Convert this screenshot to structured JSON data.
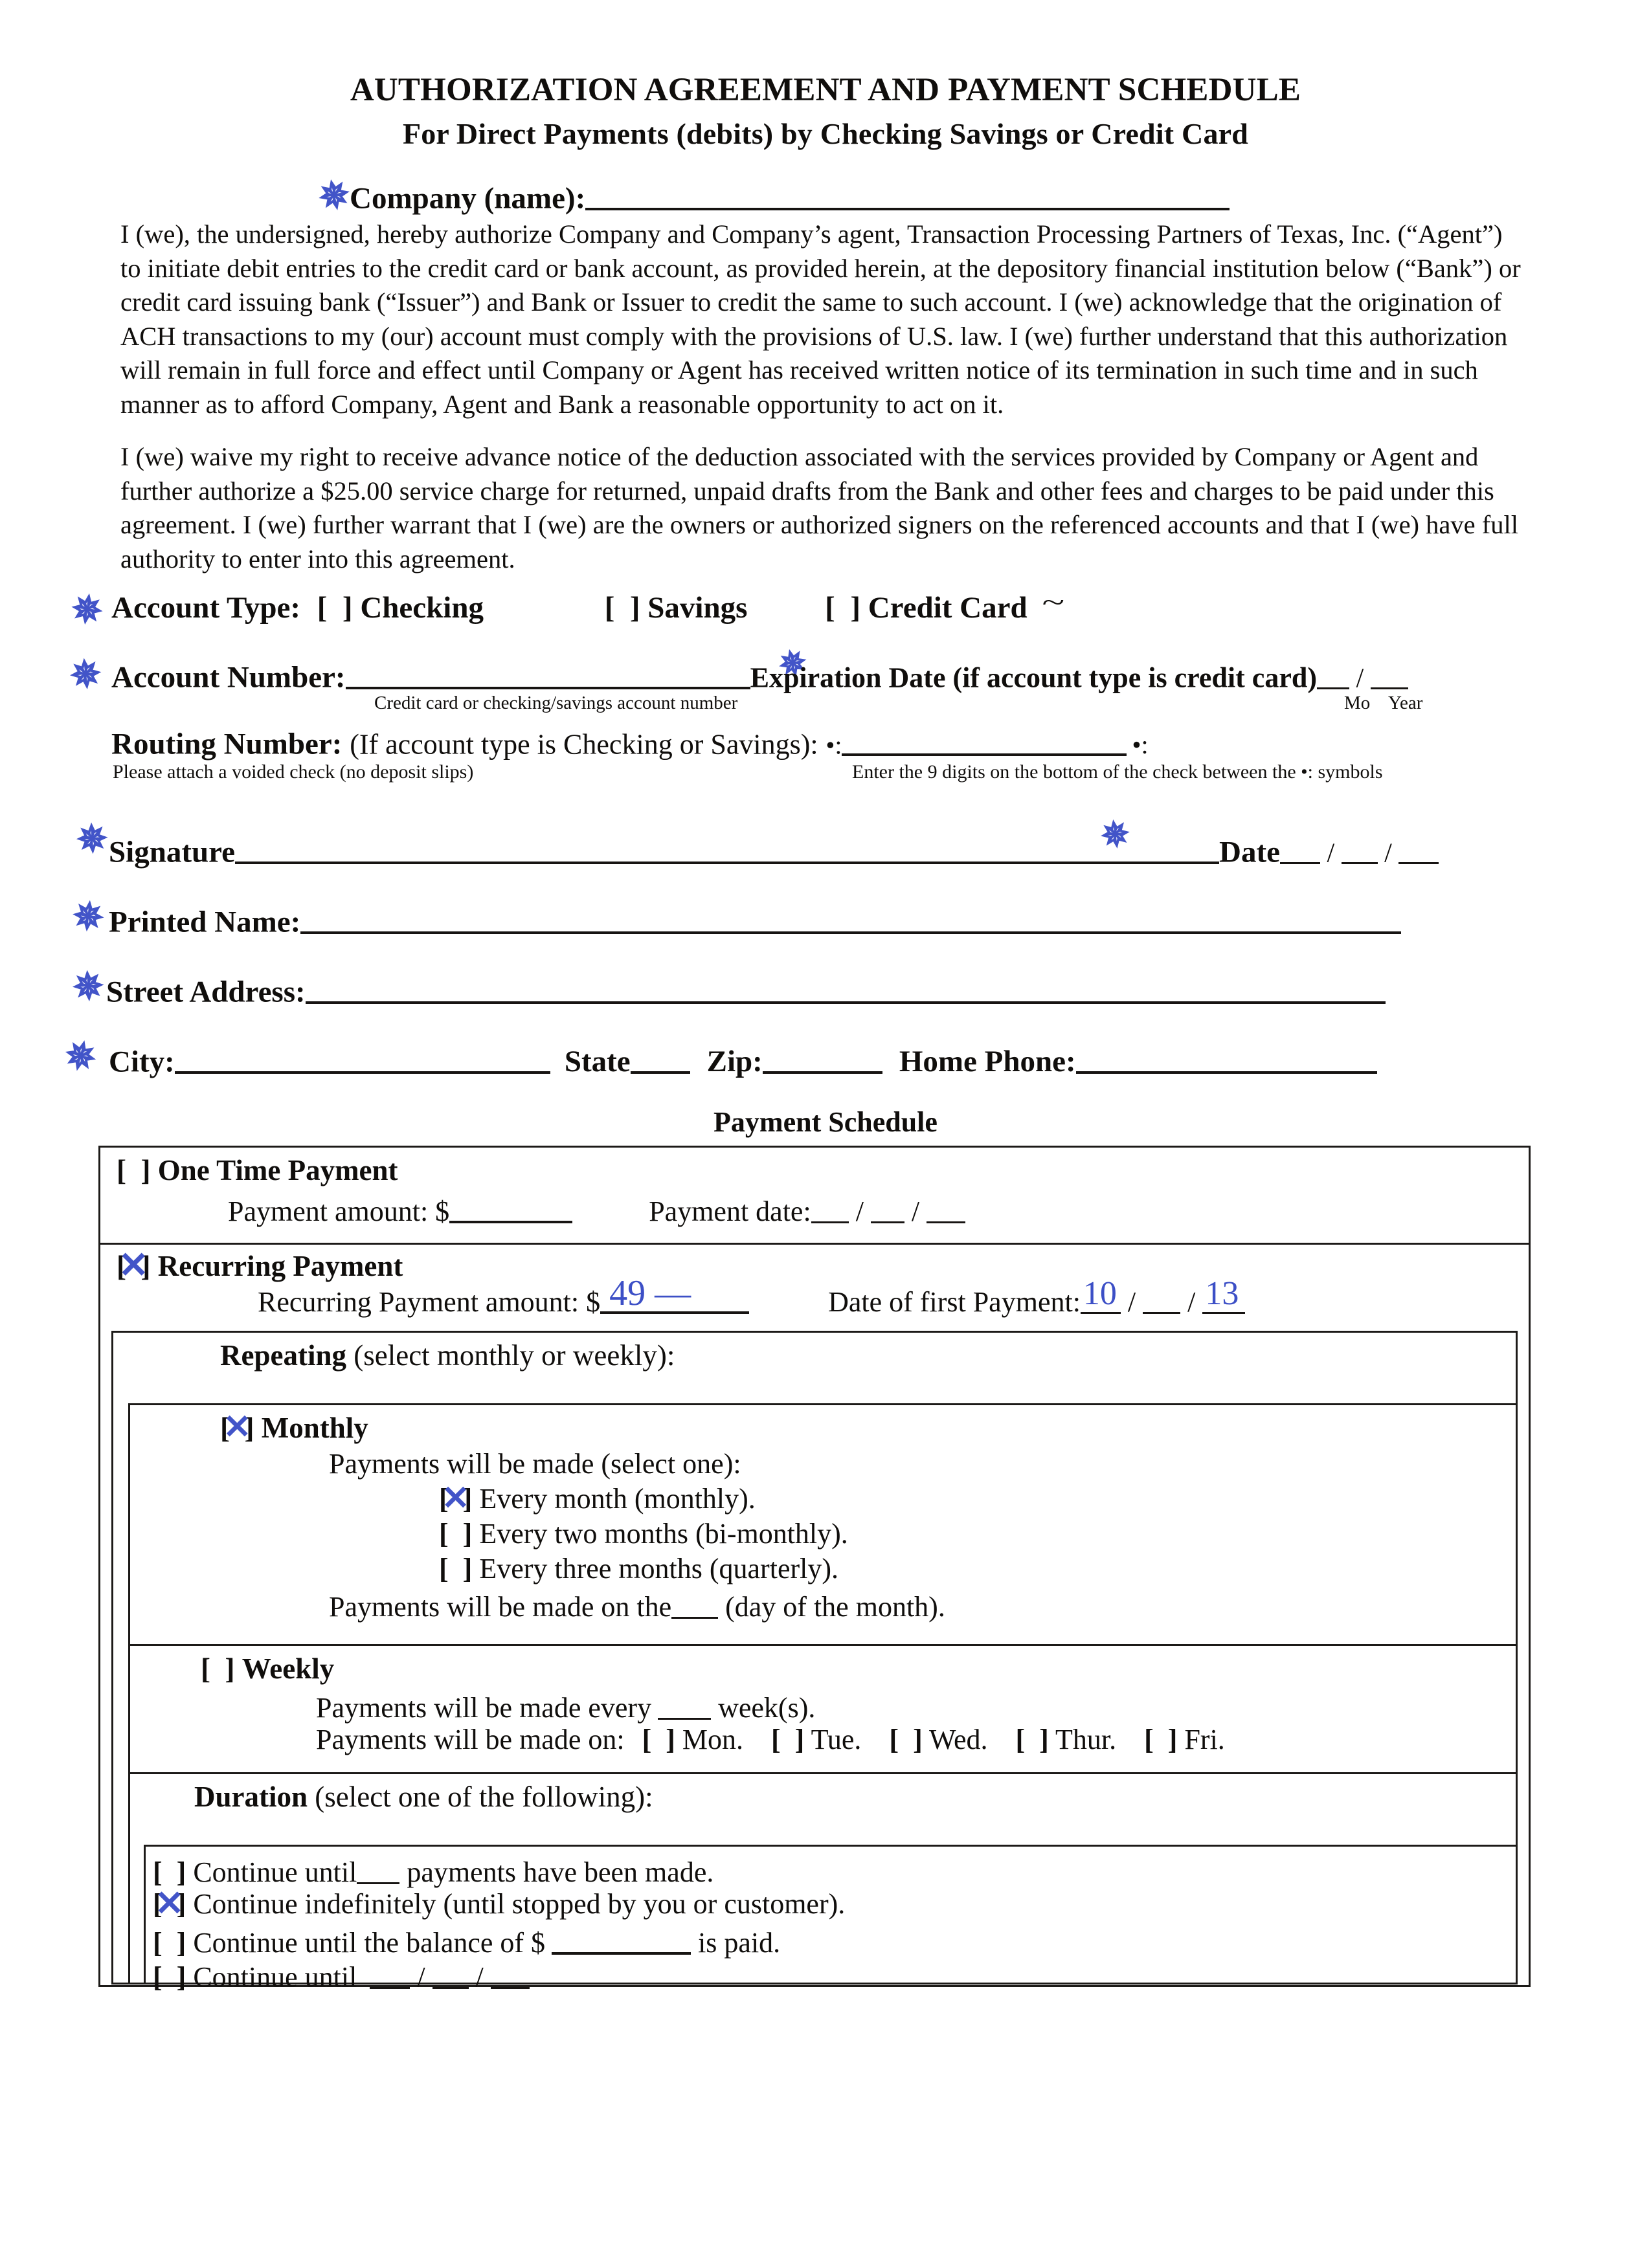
{
  "document": {
    "title_line1": "AUTHORIZATION AGREEMENT AND PAYMENT SCHEDULE",
    "title_line2": "For Direct Payments (debits) by Checking Savings or Credit Card"
  },
  "company": {
    "label": "Company (name):",
    "value": "",
    "pen_mark": "star-mark"
  },
  "body": {
    "paragraph1": "I (we), the undersigned, hereby authorize Company and Company’s agent, Transaction Processing Partners of Texas, Inc. (“Agent”) to initiate debit entries to the credit card or bank account, as provided herein, at the depository financial institution below (“Bank”) or credit card issuing bank (“Issuer”) and Bank or Issuer to credit the same to such account.  I (we) acknowledge that the origination of ACH transactions to my (our) account must comply with the provisions of U.S. law.  I (we) further understand that this authorization will remain in full force and effect until Company or Agent has received written notice of its termination in such time and in such manner as to afford Company, Agent and Bank a reasonable opportunity to act on it.",
    "paragraph2": "I (we) waive my right to receive advance notice of the deduction associated with the services provided by Company or Agent and further authorize a $25.00 service charge for returned, unpaid drafts from the Bank and other fees and charges to be paid under this agreement.  I (we) further warrant that I (we) are the owners or authorized signers on the referenced accounts and that I (we) have full authority to enter into this agreement."
  },
  "account": {
    "type_label": "Account Type:",
    "type_options": [
      {
        "label": "Checking",
        "checked": false
      },
      {
        "label": "Savings",
        "checked": false
      },
      {
        "label": "Credit Card",
        "checked": false
      }
    ],
    "credit_card_pen_squiggle": "~",
    "number_label": "Account Number:",
    "number_value": "",
    "number_caption": "Credit card or checking/savings account number",
    "expiration_label": "Expiration Date (if account type is credit card)",
    "expiration_mo": "",
    "expiration_year": "",
    "expiration_mo_caption": "Mo",
    "expiration_year_caption": "Year",
    "routing_label": "Routing Number:",
    "routing_condition": "(If account type is Checking or Savings):",
    "routing_symbol": "•:",
    "routing_value": "",
    "routing_note_left": "Please attach a voided check (no deposit slips)",
    "routing_note_right": "Enter the 9 digits on the bottom of the check between the •: symbols"
  },
  "signer": {
    "signature_label": "Signature",
    "signature_value": "",
    "date_label": "Date",
    "date_mm": "",
    "date_dd": "",
    "date_yy": "",
    "printed_name_label": "Printed Name:",
    "printed_name_value": "",
    "street_label": "Street Address:",
    "street_value": "",
    "city_label": "City:",
    "city_value": "",
    "state_label": "State",
    "state_value": "",
    "zip_label": "Zip:",
    "zip_value": "",
    "home_phone_label": "Home Phone:",
    "home_phone_value": ""
  },
  "payment_schedule": {
    "heading": "Payment Schedule",
    "one_time": {
      "label": "One Time Payment",
      "checked": false,
      "amount_label": "Payment amount: $",
      "amount_value": "",
      "date_label": "Payment date:",
      "date_mm": "",
      "date_dd": "",
      "date_yy": ""
    },
    "recurring": {
      "label": "Recurring Payment",
      "checked": true,
      "amount_label": "Recurring Payment amount: $",
      "amount_value": "49 —",
      "first_payment_label": "Date of first Payment:",
      "first_mm": "10",
      "first_dd": "",
      "first_yy": "13"
    },
    "repeating": {
      "label": "Repeating",
      "label_note": "(select monthly or weekly):",
      "monthly": {
        "label": "Monthly",
        "checked": true,
        "select_one_text": "Payments will be made (select one):",
        "options": [
          {
            "label": "Every month (monthly).",
            "checked": true
          },
          {
            "label": "Every two months (bi-monthly).",
            "checked": false
          },
          {
            "label": "Every three months (quarterly).",
            "checked": false
          }
        ],
        "day_line_pre": "Payments will be made on the",
        "day_value": "",
        "day_line_post": "(day of the month)."
      },
      "weekly": {
        "label": "Weekly",
        "checked": false,
        "every_pre": "Payments will be made every",
        "every_value": "",
        "every_post": "week(s).",
        "days_pre": "Payments will be made on:",
        "days": [
          {
            "label": "Mon.",
            "checked": false
          },
          {
            "label": "Tue.",
            "checked": false
          },
          {
            "label": "Wed.",
            "checked": false
          },
          {
            "label": "Thur.",
            "checked": false
          },
          {
            "label": "Fri.",
            "checked": false
          }
        ]
      },
      "duration": {
        "label": "Duration",
        "label_note": "(select one of the following):",
        "options": [
          {
            "pre": "Continue until",
            "value": "",
            "post": "payments have been made.",
            "checked": false,
            "kind": "count"
          },
          {
            "pre": "Continue indefinitely (until stopped by you or customer).",
            "value": "",
            "post": "",
            "checked": true,
            "kind": "plain"
          },
          {
            "pre": "Continue until the balance of $",
            "value": "",
            "post": "is paid.",
            "checked": false,
            "kind": "amount"
          },
          {
            "pre": "Continue until",
            "value": "",
            "post": "",
            "checked": false,
            "kind": "date"
          }
        ]
      }
    }
  },
  "colors": {
    "ink": "#100e0c",
    "pen_blue": "#4254c8",
    "rule": "#171412",
    "page_bg": "#ffffff"
  }
}
